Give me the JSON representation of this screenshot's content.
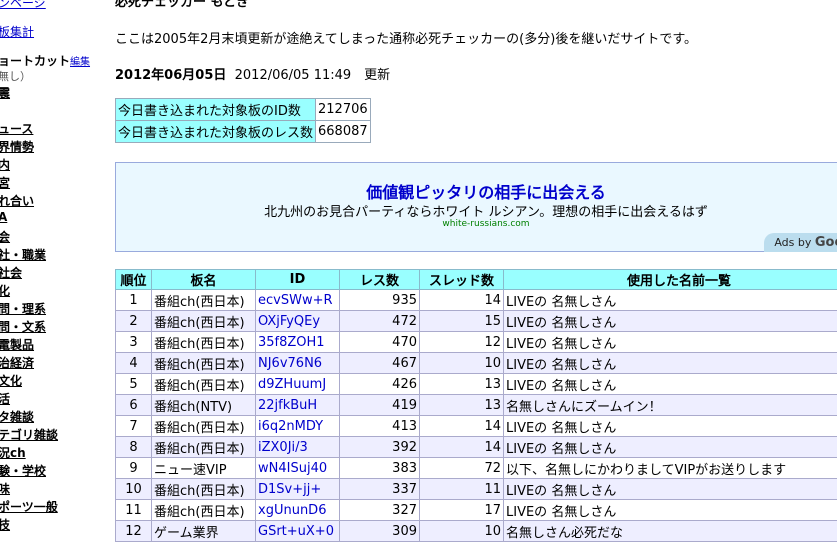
{
  "sidebar": {
    "top_link": "ンページ",
    "board_total": "板集計",
    "shortcut": "ョートカット",
    "shortcut_edit": "編集",
    "note": "無し）",
    "items": [
      "震",
      "",
      "ュース",
      "界情勢",
      "内",
      "宮",
      "れ合い",
      "A",
      "会",
      "社・職業",
      "社会",
      "化",
      "問・理系",
      "問・文系",
      "電製品",
      "治経済",
      "文化",
      "活",
      "タ雑談",
      "テゴリ雑談",
      "況ch",
      "験・学校",
      "味",
      "ポーツ一般",
      "技"
    ]
  },
  "header": {
    "title_cut": "必死チェッカー もどき",
    "intro": "ここは2005年2月末頃更新が途絶えてしまった通称必死チェッカーの(多分)後を継いだサイトです。",
    "date_bold": "2012年06月05日",
    "date_rest": "2012/06/05 11:49　更新"
  },
  "stats": [
    {
      "label": "今日書き込まれた対象板のID数",
      "value": "212706"
    },
    {
      "label": "今日書き込まれた対象板のレス数",
      "value": "668087"
    }
  ],
  "ad": {
    "title": "価値観ピッタリの相手に出会える",
    "desc": "北九州のお見合パーティならホワイト ルシアン。理想の相手に出会えるはず",
    "url": "white-russians.com",
    "ads_by": "Ads by",
    "google": "Google"
  },
  "ranking": {
    "headers": [
      "順位",
      "板名",
      "ID",
      "レス数",
      "スレッド数",
      "使用した名前一覧"
    ],
    "rows": [
      [
        "1",
        "番組ch(西日本)",
        "ecvSWw+R",
        "935",
        "14",
        "LIVEの 名無しさん"
      ],
      [
        "2",
        "番組ch(西日本)",
        "OXjFyQEy",
        "472",
        "15",
        "LIVEの 名無しさん"
      ],
      [
        "3",
        "番組ch(西日本)",
        "35f8ZOH1",
        "470",
        "12",
        "LIVEの 名無しさん"
      ],
      [
        "4",
        "番組ch(西日本)",
        "NJ6v76N6",
        "467",
        "10",
        "LIVEの 名無しさん"
      ],
      [
        "5",
        "番組ch(西日本)",
        "d9ZHuumJ",
        "426",
        "13",
        "LIVEの 名無しさん"
      ],
      [
        "6",
        "番組ch(NTV)",
        "22jfkBuH",
        "419",
        "13",
        "名無しさんにズームイン！"
      ],
      [
        "7",
        "番組ch(西日本)",
        "i6q2nMDY",
        "413",
        "14",
        "LIVEの 名無しさん"
      ],
      [
        "8",
        "番組ch(西日本)",
        "iZX0Ji/3",
        "392",
        "14",
        "LIVEの 名無しさん"
      ],
      [
        "9",
        "ニュー速VIP",
        "wN4ISuj40",
        "383",
        "72",
        "以下、名無しにかわりましてVIPがお送りします"
      ],
      [
        "10",
        "番組ch(西日本)",
        "D1Sv+jj+",
        "337",
        "11",
        "LIVEの 名無しさん"
      ],
      [
        "11",
        "番組ch(西日本)",
        "xgUnunD6",
        "327",
        "17",
        "LIVEの 名無しさん"
      ],
      [
        "12",
        "ゲーム業界",
        "GSrt+uX+0",
        "309",
        "10",
        "名無しさん必死だな"
      ]
    ]
  }
}
